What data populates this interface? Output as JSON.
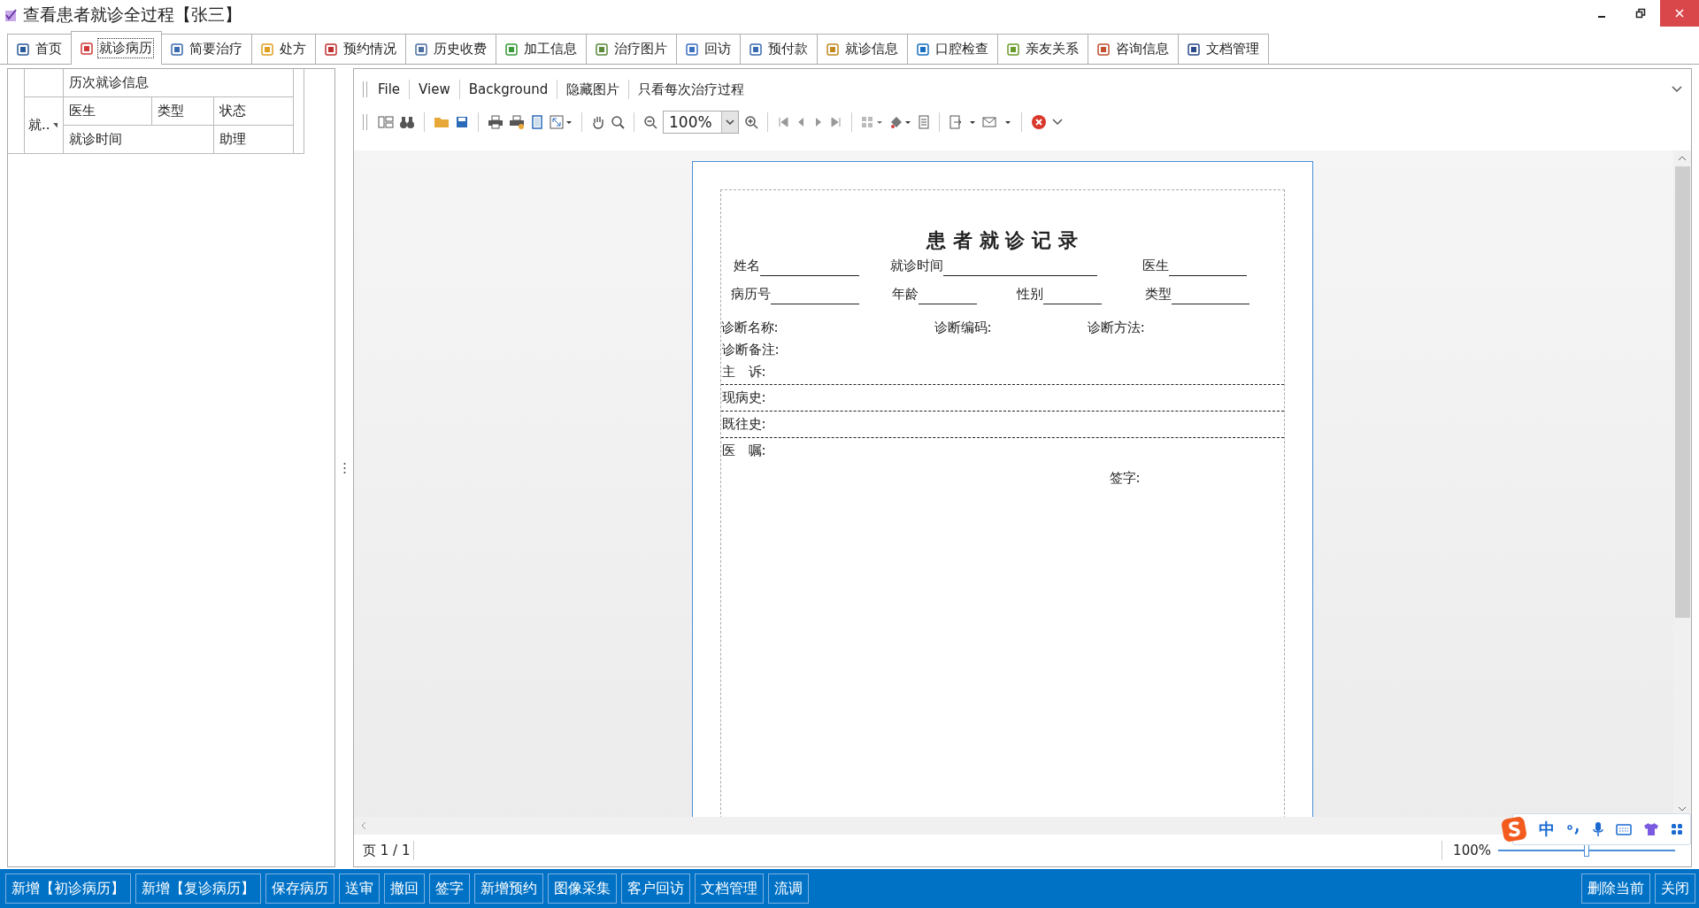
{
  "window": {
    "title": "查看患者就诊全过程【张三】"
  },
  "tabs": [
    {
      "label": "首页",
      "selected": false
    },
    {
      "label": "就诊病历",
      "selected": true
    },
    {
      "label": "简要治疗",
      "selected": false
    },
    {
      "label": "处方",
      "selected": false
    },
    {
      "label": "预约情况",
      "selected": false
    },
    {
      "label": "历史收费",
      "selected": false
    },
    {
      "label": "加工信息",
      "selected": false
    },
    {
      "label": "治疗图片",
      "selected": false
    },
    {
      "label": "回访",
      "selected": false
    },
    {
      "label": "预付款",
      "selected": false
    },
    {
      "label": "就诊信息",
      "selected": false
    },
    {
      "label": "口腔检查",
      "selected": false
    },
    {
      "label": "亲友关系",
      "selected": false
    },
    {
      "label": "咨询信息",
      "selected": false
    },
    {
      "label": "文档管理",
      "selected": false
    }
  ],
  "visit_grid": {
    "band": "历次就诊信息",
    "filter_column": "就..",
    "columns_top": [
      "医生",
      "类型",
      "状态"
    ],
    "columns_bottom": [
      "就诊时间",
      "助理"
    ]
  },
  "viewer": {
    "menu": [
      "File",
      "View",
      "Background",
      "隐藏图片",
      "只看每次治疗过程"
    ],
    "zoom_combo": "100%",
    "document": {
      "title": "患 者 就 诊 记 录",
      "row_1": [
        "姓名",
        "就诊时间",
        "医生"
      ],
      "row_2": [
        "病历号",
        "年龄",
        "性别",
        "类型"
      ],
      "diagnosis": [
        "诊断名称:",
        "诊断编码:",
        "诊断方法:"
      ],
      "sections": [
        "诊断备注:",
        "主　诉:",
        "现病史:",
        "既往史:",
        "医　嘱:"
      ],
      "signature": "签字:"
    },
    "page_status": "页 1 / 1",
    "zoom_reading": "100%",
    "zoom_slider": {
      "level": 0.5
    }
  },
  "ime_toolbar": {
    "mode": "中"
  },
  "actions_left": [
    "新增【初诊病历】",
    "新增【复诊病历】",
    "保存病历",
    "送审",
    "撤回",
    "签字",
    "新增预约",
    "图像采集",
    "客户回访",
    "文档管理",
    "流调"
  ],
  "actions_right": [
    "删除当前",
    "关闭"
  ]
}
